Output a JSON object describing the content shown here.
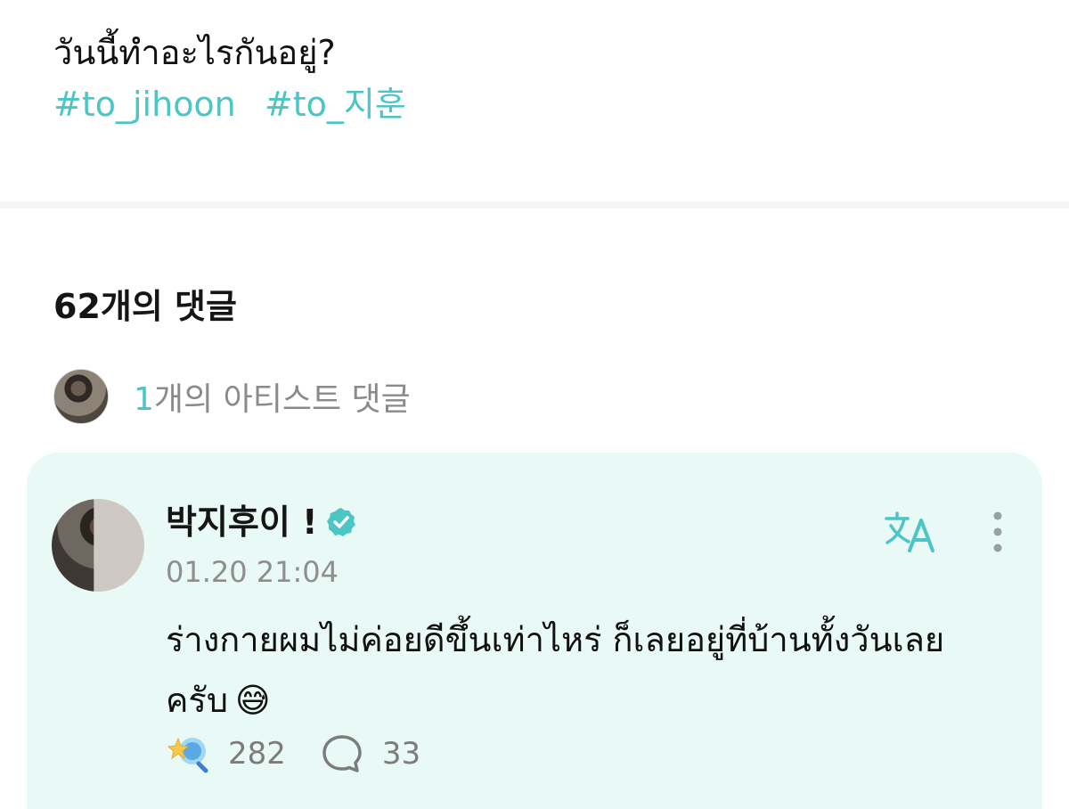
{
  "post": {
    "text": "วันนี้ทำอะไรกันอยู่?",
    "hashtags": [
      "#to_jihoon",
      "#to_지훈"
    ]
  },
  "comments_header": {
    "count_label": "62개의 댓글"
  },
  "artist_comments": {
    "count": "1",
    "label": "개의 아티스트 댓글"
  },
  "comment": {
    "author": "박지후이 !",
    "timestamp": "01.20 21:04",
    "text": "ร่างกายผมไม่ค่อยดีขึ้นเท่าไหร่ ก็เลยอยู่ที่บ้านทั้งวันเลยครับ",
    "emoji": "😅",
    "likes": "282",
    "replies": "33"
  },
  "icons": {
    "verified": "verified-check-icon",
    "translate": "translate-icon",
    "more": "more-vertical-icon",
    "like": "star-wand-icon",
    "reply": "comment-bubble-icon"
  },
  "colors": {
    "accent": "#4cc6c5",
    "card_bg": "#e8f9f6",
    "muted_text": "#8e8e8e"
  }
}
